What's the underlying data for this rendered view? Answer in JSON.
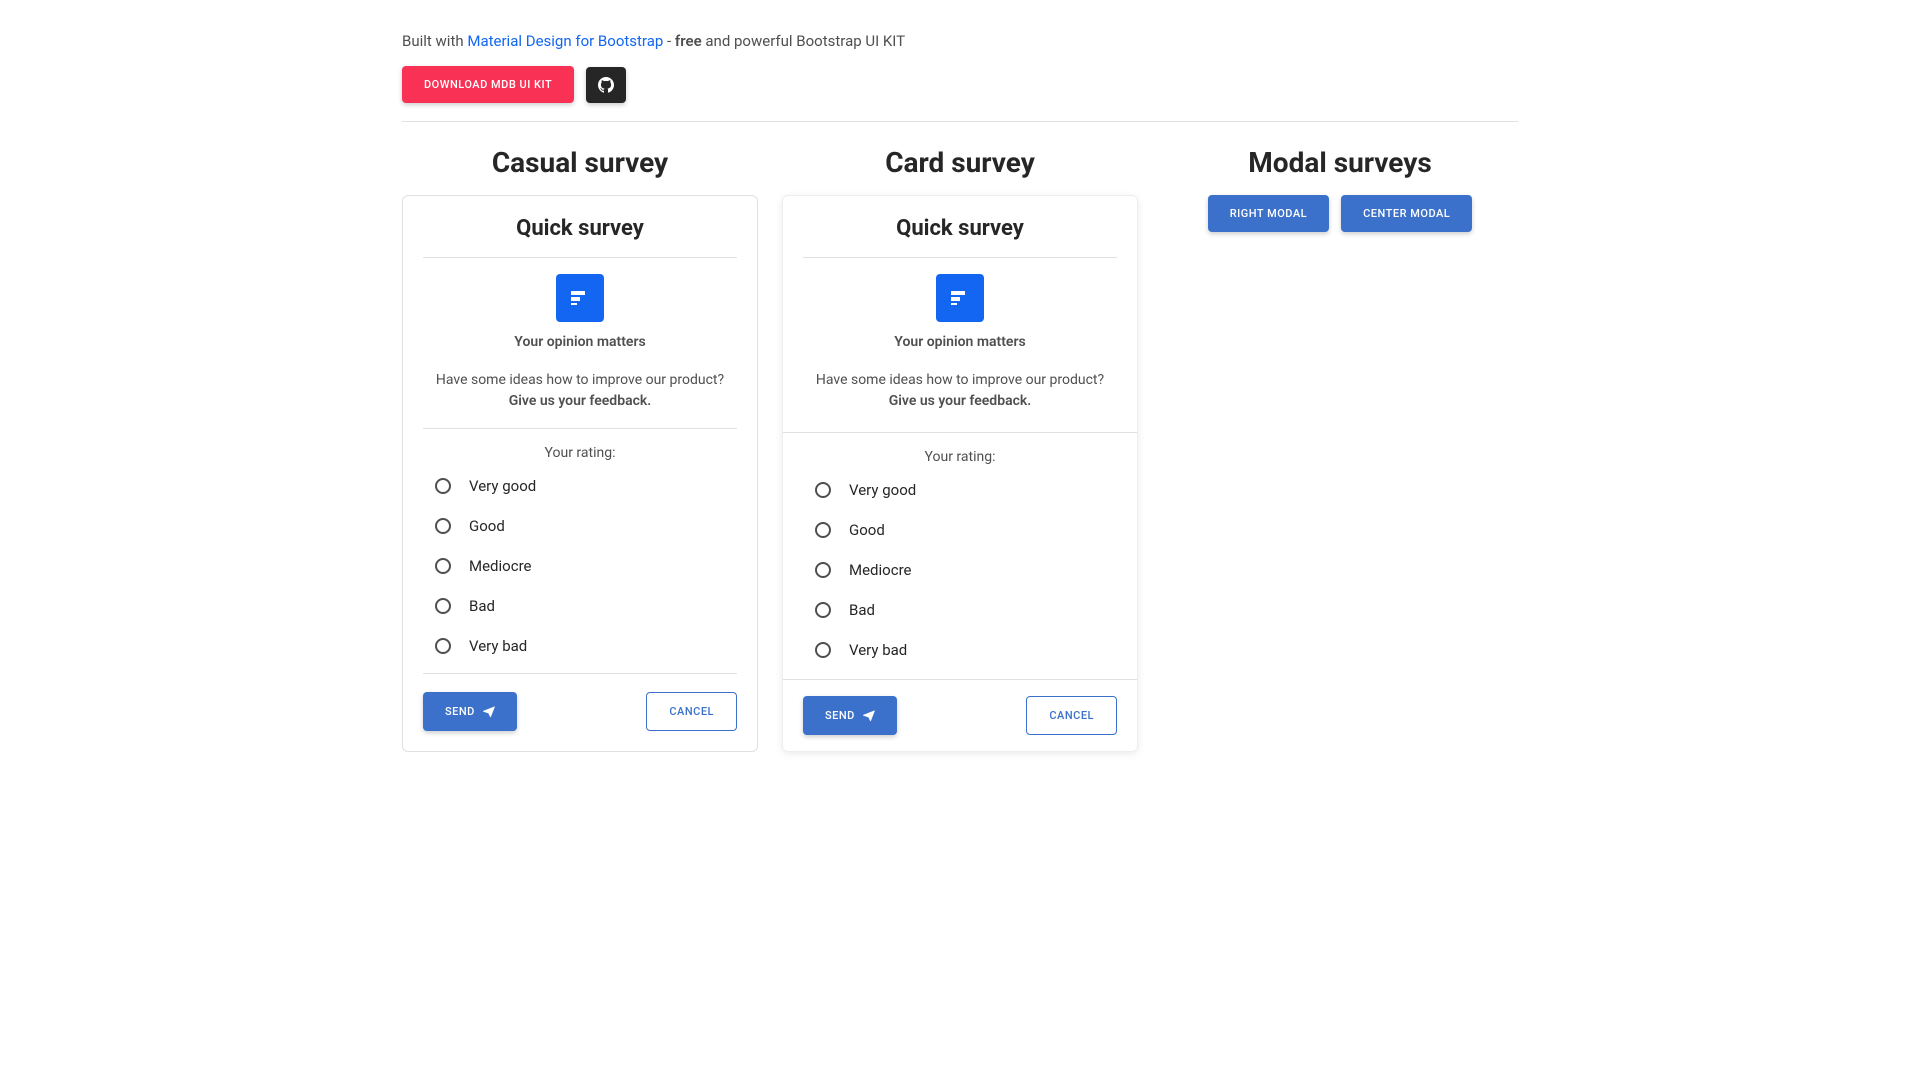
{
  "header": {
    "prefix": "Built with ",
    "link_text": "Material Design for Bootstrap",
    "mid": " - ",
    "strong": "free",
    "suffix": " and powerful Bootstrap UI KIT",
    "download_label": "DOWNLOAD MDB UI KIT"
  },
  "sections": {
    "casual_title": "Casual survey",
    "card_title": "Card survey",
    "modal_title": "Modal surveys"
  },
  "survey": {
    "heading": "Quick survey",
    "opinion": "Your opinion matters",
    "improve_text": "Have some ideas how to improve our product? ",
    "improve_strong": "Give us your feedback.",
    "rating_label": "Your rating:",
    "options": {
      "o1": "Very good",
      "o2": "Good",
      "o3": "Mediocre",
      "o4": "Bad",
      "o5": "Very bad"
    },
    "send_label": "SEND",
    "cancel_label": "CANCEL"
  },
  "modal_buttons": {
    "right": "RIGHT MODAL",
    "center": "CENTER MODAL"
  },
  "icons": {
    "github": "github-icon",
    "poll": "poll-icon",
    "send": "paper-plane-icon"
  }
}
